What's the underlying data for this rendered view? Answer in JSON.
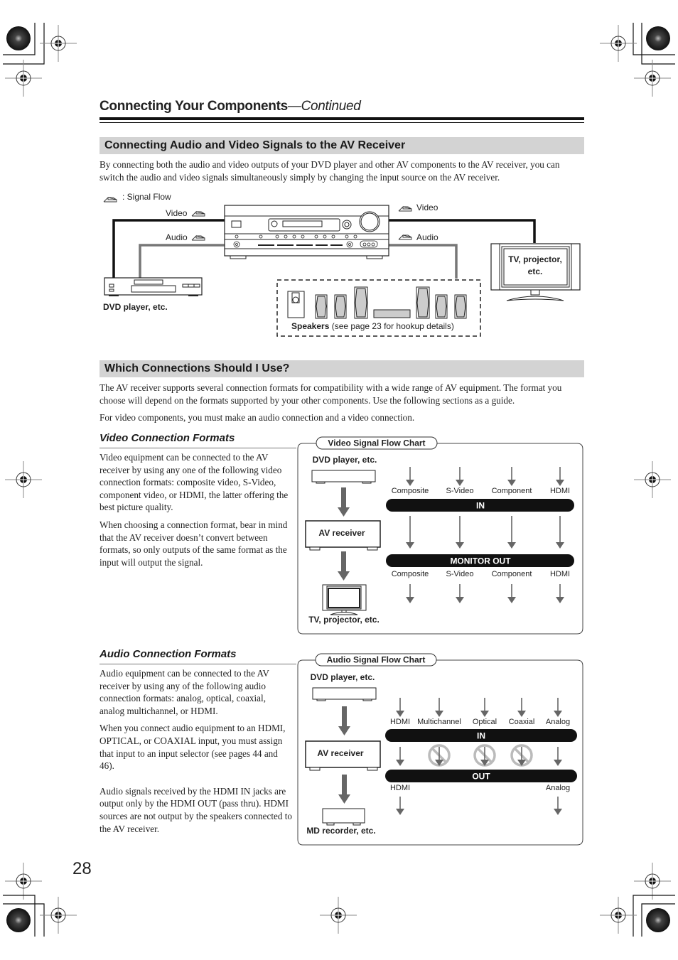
{
  "header": {
    "title": "Connecting Your Components",
    "title_suffix": "—Continued"
  },
  "section1": {
    "heading": "Connecting Audio and Video Signals to the AV Receiver",
    "paragraph": "By connecting both the audio and video outputs of your DVD player and other AV components to the AV receiver, you can switch the audio and video signals simultaneously simply by changing the input source on the AV receiver.",
    "diagram": {
      "legend": ": Signal Flow",
      "left_video_label": "Video",
      "left_audio_label": "Audio",
      "right_video_label": "Video",
      "right_audio_label": "Audio",
      "source_label": "DVD player, etc.",
      "display_label_line1": "TV, projector,",
      "display_label_line2": "etc.",
      "speakers_label_bold": "Speakers",
      "speakers_label_rest": " (see page 23 for hookup details)"
    }
  },
  "section2": {
    "heading": "Which Connections Should I Use?",
    "paragraph1": "The AV receiver supports several connection formats for compatibility with a wide range of AV equipment. The format you choose will depend on the formats supported by your other components. Use the following sections as a guide.",
    "paragraph2": "For video components, you must make an audio connection and a video connection."
  },
  "video_formats": {
    "heading": "Video Connection Formats",
    "paragraphs": [
      "Video equipment can be connected to the AV receiver by using any one of the following video connection formats: composite video, S-Video, component video, or HDMI, the latter offering the best picture quality.",
      "When choosing a connection format, bear in mind that the AV receiver doesn’t convert between formats, so only outputs of the same format as the input will output the signal."
    ],
    "chart": {
      "title": "Video Signal Flow Chart",
      "source": "DVD player, etc.",
      "receiver": "AV receiver",
      "destination": "TV, projector, etc.",
      "in_bar": "IN",
      "out_bar": "MONITOR OUT",
      "inputs": [
        "Composite",
        "S-Video",
        "Component",
        "HDMI"
      ],
      "outputs": [
        "Composite",
        "S-Video",
        "Component",
        "HDMI"
      ]
    }
  },
  "audio_formats": {
    "heading": "Audio Connection Formats",
    "paragraphs": [
      "Audio equipment can be connected to the AV receiver by using any of the following audio connection formats: analog, optical, coaxial, analog multichannel, or HDMI.",
      "When you connect audio equipment to an HDMI, OPTICAL, or COAXIAL input, you must assign that input to an input selector (see pages 44 and 46).",
      "Audio signals received by the HDMI IN jacks are output only by the HDMI OUT (pass thru). HDMI sources are not output by the speakers connected to the AV receiver."
    ],
    "chart": {
      "title": "Audio Signal Flow Chart",
      "source": "DVD player, etc.",
      "receiver": "AV receiver",
      "destination": "MD recorder, etc.",
      "in_bar": "IN",
      "out_bar": "OUT",
      "inputs": [
        "HDMI",
        "Multichannel",
        "Optical",
        "Coaxial",
        "Analog"
      ],
      "blocked": [
        false,
        true,
        true,
        true,
        false
      ],
      "outputs": [
        "HDMI",
        "Analog"
      ]
    }
  },
  "page_number": "28"
}
